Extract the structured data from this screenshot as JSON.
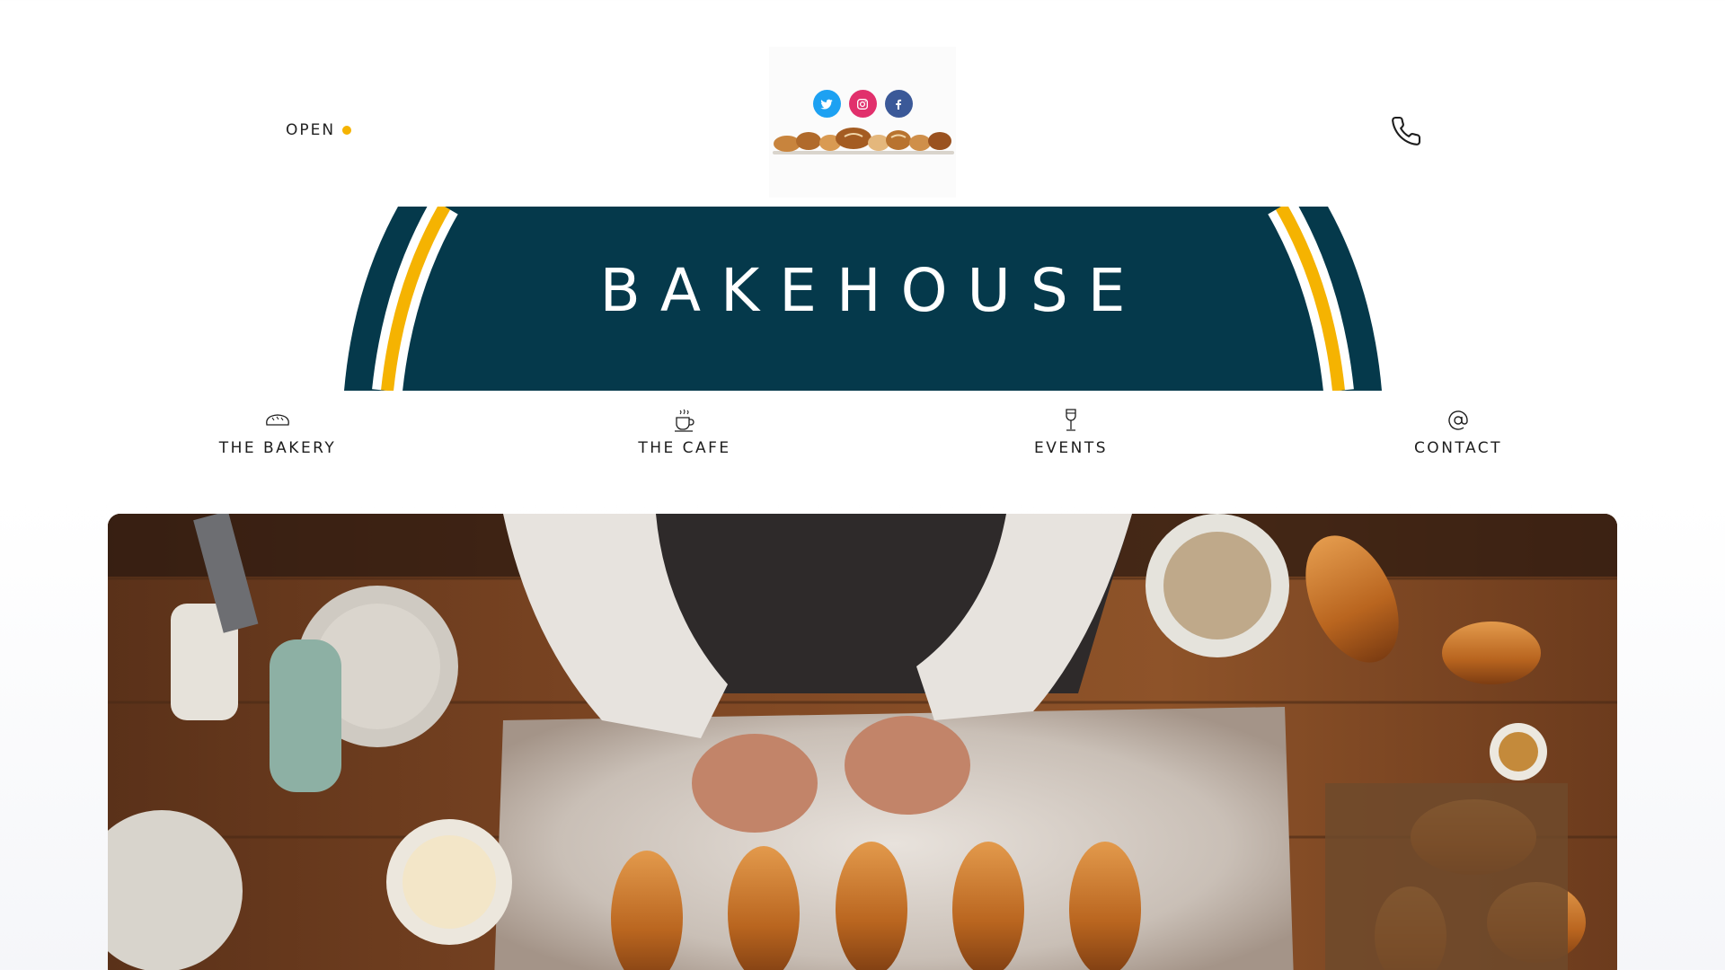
{
  "header": {
    "status_label": "OPEN",
    "status_color": "#f5b301",
    "socials": [
      {
        "name": "twitter",
        "color": "#1da1f2"
      },
      {
        "name": "instagram",
        "color": "#e1306c"
      },
      {
        "name": "facebook",
        "color": "#3b5998"
      }
    ],
    "phone_icon": "phone-icon"
  },
  "banner": {
    "title": "BAKEHOUSE",
    "colors": {
      "background": "#05394b",
      "stripe_gold": "#f5b301",
      "stripe_white": "#ffffff"
    }
  },
  "nav": {
    "items": [
      {
        "label": "THE BAKERY",
        "icon": "bread-icon"
      },
      {
        "label": "THE CAFE",
        "icon": "coffee-cup-icon"
      },
      {
        "label": "EVENTS",
        "icon": "wine-glass-icon"
      },
      {
        "label": "CONTACT",
        "icon": "at-sign-icon"
      }
    ]
  },
  "hero": {
    "image": "baker-shaping-croissants-photo"
  }
}
